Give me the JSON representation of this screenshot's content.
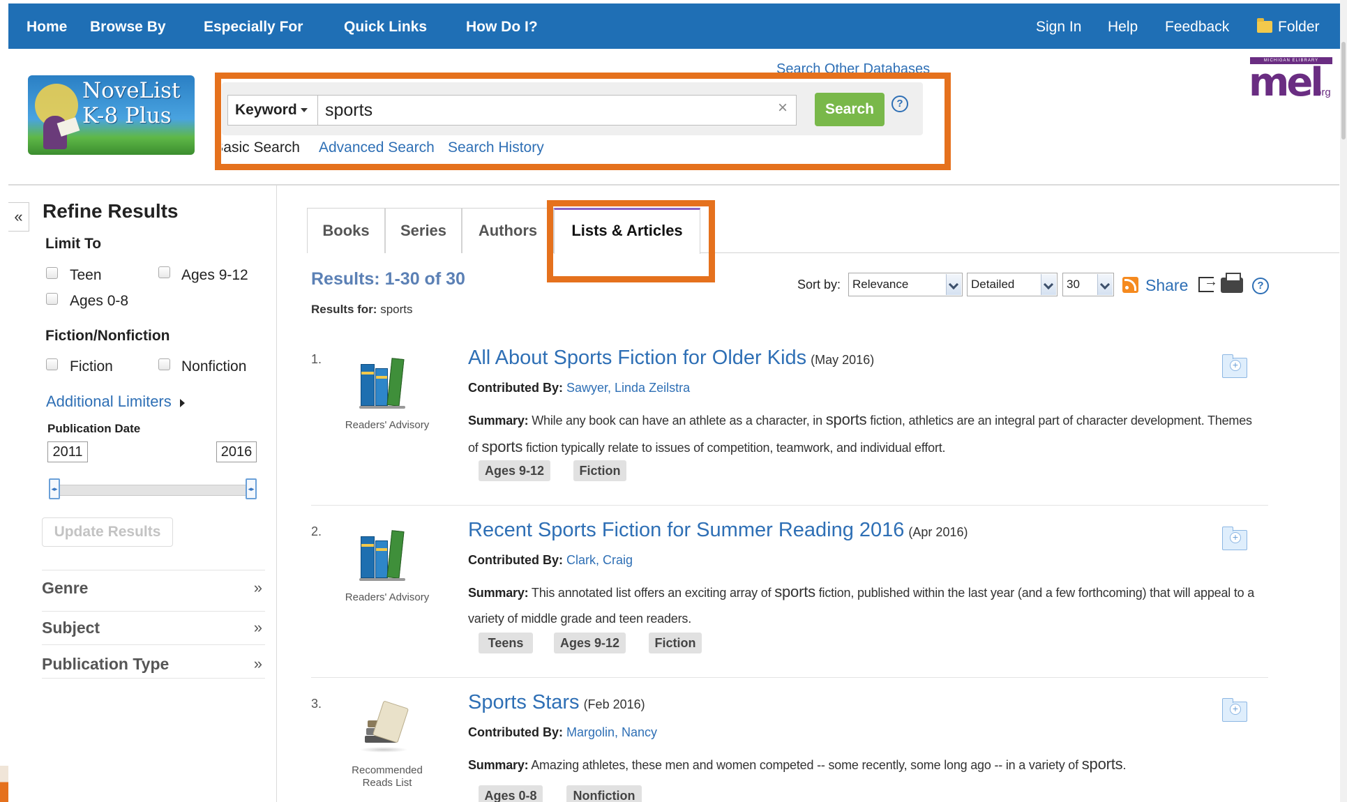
{
  "topnav": {
    "left": [
      "Home",
      "Browse By",
      "Especially For",
      "Quick Links",
      "How Do I?"
    ],
    "right": [
      "Sign In",
      "Help",
      "Feedback",
      "Folder"
    ]
  },
  "logo": {
    "line1": "NoveList",
    "line2": "K-8 Plus"
  },
  "mel_logo": {
    "band": "MICHIGAN ELIBRARY",
    "main": "mel",
    "org": "org"
  },
  "search": {
    "other_databases": "Search Other Databases",
    "field_type": "Keyword",
    "query": "sports",
    "clear": "×",
    "button": "Search",
    "help": "?",
    "links": [
      "Basic Search",
      "Advanced Search",
      "Search History"
    ]
  },
  "sidebar": {
    "collapse": "«",
    "title": "Refine Results",
    "limit_to": "Limit To",
    "limit_options": [
      "Teen",
      "Ages 9-12",
      "Ages 0-8"
    ],
    "fiction_heading": "Fiction/Nonfiction",
    "fiction_options": [
      "Fiction",
      "Nonfiction"
    ],
    "additional_limiters": "Additional Limiters",
    "publication_date": "Publication Date",
    "date_from": "2011",
    "date_to": "2016",
    "update_button": "Update Results",
    "facets": [
      "Genre",
      "Subject",
      "Publication Type"
    ],
    "facet_chevron": "»"
  },
  "tabs": [
    "Books",
    "Series",
    "Authors",
    "Lists & Articles"
  ],
  "results": {
    "count": "Results: 1-30 of 30",
    "for_label": "Results for:",
    "for_value": "sports",
    "sort_label": "Sort by:",
    "sort_value": "Relevance",
    "view_value": "Detailed",
    "per_page": "30",
    "share": "Share",
    "help": "?",
    "items": [
      {
        "num": "1.",
        "caption": "Readers' Advisory",
        "title": "All About Sports Fiction for Older Kids",
        "date": "(May 2016)",
        "contrib_label": "Contributed By:",
        "contrib": "Sawyer, Linda Zeilstra",
        "summary_label": "Summary:",
        "summary_pre": "While any book can have an athlete as a character, in",
        "summary_hl": "sports",
        "summary_post": "fiction, athletics are an integral part of character development. Themes of",
        "summary_hl2": "sports",
        "summary_post2": "fiction typically relate to issues of competition, teamwork, and individual effort.",
        "tags": [
          "Ages 9-12",
          "Fiction"
        ]
      },
      {
        "num": "2.",
        "caption": "Readers' Advisory",
        "title": "Recent Sports Fiction for Summer Reading 2016",
        "date": "(Apr 2016)",
        "contrib_label": "Contributed By:",
        "contrib": "Clark, Craig",
        "summary_label": "Summary:",
        "summary_pre": "This annotated list offers an exciting array of",
        "summary_hl": "sports",
        "summary_post": "fiction, published within the last year (and a few forthcoming) that will appeal to a variety of middle grade and teen readers.",
        "tags": [
          "Teens",
          "Ages 9-12",
          "Fiction"
        ]
      },
      {
        "num": "3.",
        "caption": "Recommended Reads List",
        "title": "Sports Stars",
        "date": "(Feb 2016)",
        "contrib_label": "Contributed By:",
        "contrib": "Margolin, Nancy",
        "summary_label": "Summary:",
        "summary_pre": "Amazing athletes, these men and women competed -- some recently, some long ago -- in a variety of",
        "summary_hl": "sports",
        "summary_post": ".",
        "tags": [
          "Ages 0-8",
          "Nonfiction"
        ]
      }
    ]
  },
  "colors": {
    "nav_blue": "#1f6fb5",
    "link_blue": "#2e6fb5",
    "search_green": "#79b84a",
    "highlight_orange": "#e5711d",
    "tab_accent": "#8a63c4"
  }
}
